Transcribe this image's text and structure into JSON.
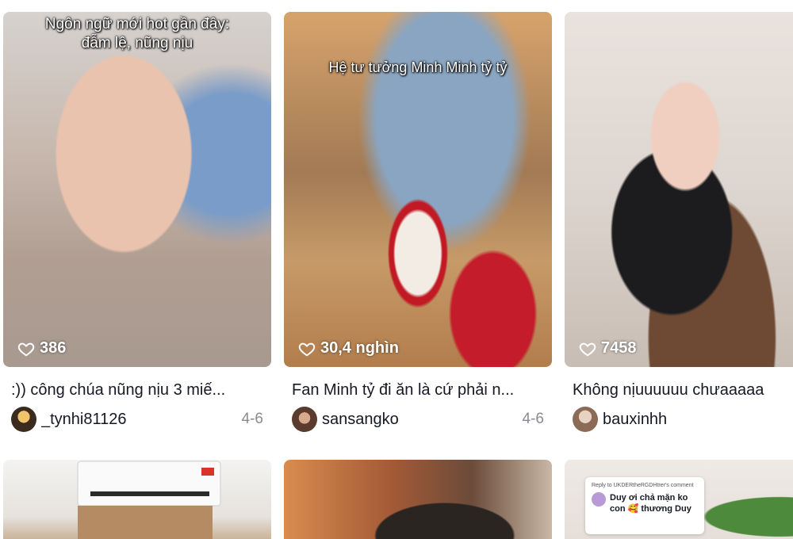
{
  "videos": [
    {
      "overlay": "Ngôn ngữ mới hot gần đây: đẫm lệ, nũng nịu",
      "likes": "386",
      "caption": ":)) công chúa nũng nịu 3 miế...",
      "username": "_tynhi81126",
      "date": "4-6"
    },
    {
      "overlay": "Hệ tư tưởng Minh Minh tỷ tỷ",
      "likes": "30,4 nghìn",
      "caption": "Fan Minh tỷ đi ăn là cứ phải n...",
      "username": "sansangko",
      "date": "4-6"
    },
    {
      "overlay": "",
      "likes": "7458",
      "caption": "Không nịuuuuuu chưaaaaa",
      "username": "bauxinhh",
      "date": ""
    },
    {
      "overlay": "",
      "likes": "",
      "caption": "",
      "username": "",
      "date": ""
    },
    {
      "overlay": "",
      "likes": "",
      "caption": "",
      "username": "",
      "date": ""
    },
    {
      "reply": {
        "head": "Reply to UKDERtheRGDHtrer's comment",
        "text": "Duy ơi chả mặn ko con 🥰 thương Duy"
      }
    }
  ],
  "icons": {
    "like": "heart-outline-icon"
  }
}
